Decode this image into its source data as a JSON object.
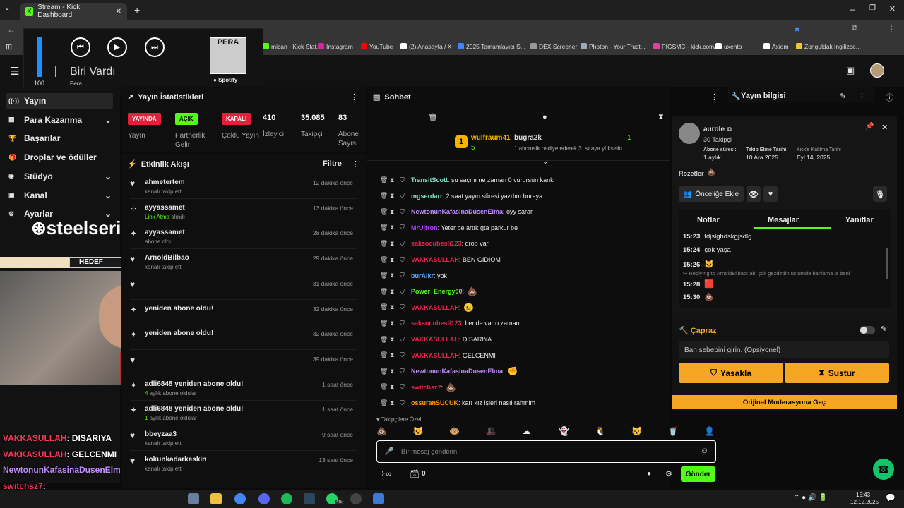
{
  "browser": {
    "tab_title": "Stream - Kick Dashboard",
    "bookmarks": [
      {
        "label": "mican - Kick Stat...",
        "color": "#53fc18"
      },
      {
        "label": "Instagram",
        "color": "#d6249f"
      },
      {
        "label": "YouTube",
        "color": "#ff0000"
      },
      {
        "label": "(2) Anasayfa / X",
        "color": "#ffffff"
      },
      {
        "label": "2025 Tamamlayıcı S...",
        "color": "#4285f4"
      },
      {
        "label": "DEX Screener",
        "color": "#999999"
      },
      {
        "label": "Photon - Your Trust...",
        "color": "#9ab"
      },
      {
        "label": "PIGSMC - kick.com/...",
        "color": "#e040a0"
      },
      {
        "label": "uxento",
        "color": "#ffffff"
      },
      {
        "label": "Axiom",
        "color": "#ffffff"
      },
      {
        "label": "Zonguldak İngilizce...",
        "color": "#f4c430"
      }
    ]
  },
  "media": {
    "volume": "100",
    "volume_level": 1.0,
    "song": "Biri Vardı",
    "artist": "Pera",
    "album_label": "PERA",
    "source": "Spotify"
  },
  "sidebar": {
    "items": [
      {
        "label": "Yayın",
        "icon": "broadcast-icon"
      },
      {
        "label": "Para Kazanma",
        "icon": "money-icon"
      },
      {
        "label": "Başarılar",
        "icon": "trophy-icon"
      },
      {
        "label": "Droplar ve ödüller",
        "icon": "gift-icon"
      },
      {
        "label": "Stüdyo",
        "icon": "studio-icon"
      },
      {
        "label": "Kanal",
        "icon": "channel-icon"
      },
      {
        "label": "Ayarlar",
        "icon": "gear-icon"
      }
    ]
  },
  "stats": {
    "title": "Yayın İstatistikleri",
    "badges": [
      {
        "label": "YAYINDA",
        "caption": "Yayın",
        "color": "#e91e3a",
        "text_color": "#ffffff"
      },
      {
        "label": "AÇIK",
        "caption": "Partnerlik Gelir",
        "color": "#53fc18",
        "text_color": "#000000"
      },
      {
        "label": "KAPALI",
        "caption": "Çoklu Yayın",
        "color": "#e91e3a",
        "text_color": "#ffffff"
      }
    ],
    "numbers": [
      {
        "value": "410",
        "label": "İzleyici"
      },
      {
        "value": "35.085",
        "label": "Takipçi"
      },
      {
        "value": "83",
        "label": "Abone Sayısı"
      }
    ]
  },
  "activity": {
    "title": "Etkinlik Akışı",
    "filter": "Filtre",
    "items": [
      {
        "name": "ahmetertem",
        "sub": "kanalı takip etti",
        "time": "12 dakika önce",
        "icon": "heart-icon"
      },
      {
        "name": "ayyassamet",
        "sub_highlight": "Link Atma",
        "sub": " alındı",
        "time": "13 dakika önce",
        "icon": "redeem-icon"
      },
      {
        "name": "ayyassamet",
        "sub": "abone oldu",
        "time": "28 dakika önce",
        "icon": "star-icon"
      },
      {
        "name": "ArnoldBilbao",
        "sub": "kanalı takip etti",
        "time": "29 dakika önce",
        "icon": "heart-icon"
      },
      {
        "name": "",
        "sub": "",
        "time": "31 dakika önce",
        "icon": "heart-icon"
      },
      {
        "name": "yeniden abone oldu!",
        "sub": "",
        "time": "32 dakika önce",
        "icon": "star-icon"
      },
      {
        "name": "yeniden abone oldu!",
        "sub": "",
        "time": "32 dakika önce",
        "icon": "star-icon"
      },
      {
        "name": "",
        "sub": "",
        "time": "39 dakika önce",
        "icon": "heart-icon"
      },
      {
        "name": "adli6848 yeniden abone oldu!",
        "sub_highlight": "4",
        "sub": " aylık abone oldular",
        "time": "1 saat önce",
        "icon": "star-icon"
      },
      {
        "name": "adli6848 yeniden abone oldu!",
        "sub_highlight": "1",
        "sub": " aylık abone oldular",
        "time": "1 saat önce",
        "icon": "star-icon"
      },
      {
        "name": "bbeyzaa3",
        "sub": "kanalı takip etti",
        "time": "9 saat önce",
        "icon": "heart-icon"
      },
      {
        "name": "kokunkadarkeskin",
        "sub": "kanalı takip etti",
        "time": "13 saat önce",
        "icon": "heart-icon"
      }
    ]
  },
  "overlay": {
    "brand": "steelseries",
    "goal": "HEDEF",
    "chat": [
      {
        "user": "VAKKASULLAH",
        "text": ": DISARIYA",
        "color": "#ff3355"
      },
      {
        "user": "VAKKASULLAH",
        "text": ": GELCENMI",
        "color": "#ff3355"
      },
      {
        "user": "NewtonunKafasinaDusenElma",
        "text": ":",
        "color": "#c38cff"
      },
      {
        "user": "switchsz7",
        "text": ":",
        "color": "#ff3355"
      },
      {
        "user": "ossuranSUCUK",
        "text": ": karı kız işleri nasıl rahmim",
        "color": "#ff9900"
      }
    ]
  },
  "chat": {
    "title": "Sohbet",
    "leaderboard": [
      {
        "rank": "1",
        "name": "wulfraum41",
        "count": "5"
      },
      {
        "name": "bugra2k",
        "count": "1",
        "note": "1 abonelik hediye ederek 3. sıraya yükselin"
      }
    ],
    "messages": [
      {
        "user": "TransitScott",
        "text": ": şu saçını ne zaman 0 vurursun kanki",
        "color": "#7fe3c9"
      },
      {
        "user": "mgserdarr",
        "text": ": 2 saat yayın süresi yazdım buraya",
        "color": "#7fe3c9"
      },
      {
        "user": "NewtonunKafasinaDusenElma",
        "text": ": oyy sarar",
        "color": "#c38cff"
      },
      {
        "user": "MrUltron",
        "text": ": Yeter be artık gta parkur be",
        "color": "#b040ff"
      },
      {
        "user": "saksocubesli123",
        "text": ": drop var",
        "color": "#e2264d"
      },
      {
        "user": "VAKKASULLAH",
        "text": ": BEN GIDIOM",
        "color": "#e2264d"
      },
      {
        "user": "burAlkr",
        "text": ": yok",
        "color": "#5aa8ff"
      },
      {
        "user": "Power_Energy00",
        "text": ":",
        "color": "#53fc18"
      },
      {
        "user": "VAKKASULLAH",
        "text": ":",
        "color": "#e2264d"
      },
      {
        "user": "saksocubesli123",
        "text": ": bende var o zaman",
        "color": "#e2264d"
      },
      {
        "user": "VAKKASULLAH",
        "text": ": DISARIYA",
        "color": "#e2264d"
      },
      {
        "user": "VAKKASULLAH",
        "text": ": GELCENMI",
        "color": "#e2264d"
      },
      {
        "user": "NewtonunKafasinaDusenElma",
        "text": ":",
        "color": "#c38cff"
      },
      {
        "user": "switchsz7",
        "text": ":",
        "color": "#e2264d"
      },
      {
        "user": "ossuranSUCUK",
        "text": ": karı kız işleri nasıl rahmim",
        "color": "#ff9900"
      }
    ],
    "follower_only": "Takipçilere Özel",
    "input_placeholder": "Bir mesaj gönderin",
    "send": "Gönder",
    "infinity_count": "0"
  },
  "info": {
    "title": "Yayın bilgisi",
    "user": "aurole",
    "followers": "30 Takipçi",
    "sub_label": "Abone süresi:",
    "sub_value": "1 aylık",
    "follow_label": "Takip Etme Tarihi",
    "follow_value": "10 Ara 2025",
    "kick_label": "Kick'e Katılma Tarihi",
    "kick_value": "Eyl 14, 2025",
    "badges_label": "Rozetler",
    "priority": "Önceliğe Ekle",
    "tabs": [
      "Notlar",
      "Mesajlar",
      "Yanıtlar"
    ],
    "messages": [
      {
        "time": "15:23",
        "text": "fdjslghdskgjsdlg"
      },
      {
        "time": "15:24",
        "text": "çok yaşa"
      },
      {
        "time": "15:26",
        "text": ""
      },
      {
        "time": "15:28",
        "text": ""
      },
      {
        "time": "15:30",
        "text": ""
      }
    ],
    "reply": "Replying to ArnoldBilbao: abi çok gezdirdin üstümde banlama la beni",
    "cross_title": "Çapraz",
    "ban_placeholder": "Ban sebebini girin. (Opsiyonel)",
    "ban": "Yasakla",
    "mute": "Sustur",
    "orig_mod": "Orijinal Moderasyona Geç"
  },
  "taskbar": {
    "time": "15:43",
    "date": "12.12.2025",
    "badge": "45"
  }
}
